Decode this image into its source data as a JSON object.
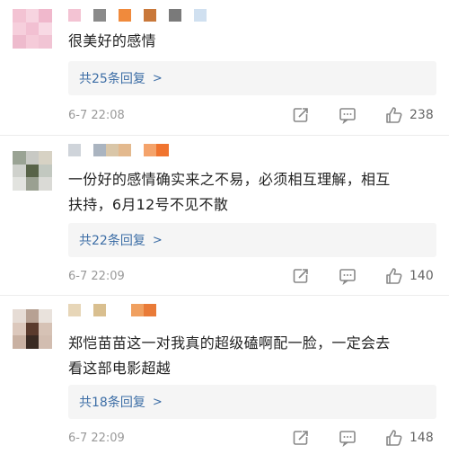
{
  "comments": [
    {
      "text": "很美好的感情",
      "replies": "共25条回复",
      "chevron": ">",
      "time": "6-7 22:08",
      "likes": "238",
      "avatar_colors": [
        "#f3c3d3",
        "#f7d4e0",
        "#f0b8cc",
        "#f6cfdc",
        "#f2c0d2",
        "#f8d9e4",
        "#eebbcd",
        "#f5cbd9",
        "#f1c4d4"
      ],
      "name_colors": [
        "#f3c3d3",
        "#ffffff",
        "#8a8a8a",
        "#ffffff",
        "#f08a3c",
        "#ffffff",
        "#c9783a",
        "#ffffff",
        "#7a7a7a",
        "#ffffff",
        "#d0e0f0"
      ]
    },
    {
      "text_lines": [
        "一份好的感情确实来之不易，必须相互理解，相互",
        "扶持，6月12号不见不散"
      ],
      "replies": "共22条回复",
      "chevron": ">",
      "time": "6-7 22:09",
      "likes": "140",
      "avatar_colors": [
        "#9aa394",
        "#c8c9c4",
        "#d7d2c4",
        "#cfd1cc",
        "#586348",
        "#c2c8c0",
        "#e2e3df",
        "#9aa091",
        "#dadad6"
      ],
      "name_colors": [
        "#cfd4da",
        "#ffffff",
        "#aab4c0",
        "#d9c6a8",
        "#e3b98e",
        "#ffffff",
        "#f4a36b",
        "#f0742f"
      ]
    },
    {
      "text_lines": [
        "郑恺苗苗这一对我真的超级磕啊配一脸，一定会去",
        "看这部电影超越"
      ],
      "replies": "共18条回复",
      "chevron": ">",
      "time": "6-7 22:09",
      "likes": "148",
      "avatar_colors": [
        "#e6dcd5",
        "#b7a193",
        "#e9e2dc",
        "#dcc8bc",
        "#5b3b2d",
        "#d6c2b5",
        "#c9b1a2",
        "#3a2a22",
        "#d2bdb0"
      ],
      "name_colors": [
        "#e7d6b8",
        "#ffffff",
        "#d9bf8f",
        "#ffffff",
        "#ffffff",
        "#f0a060",
        "#e97b38"
      ]
    }
  ]
}
